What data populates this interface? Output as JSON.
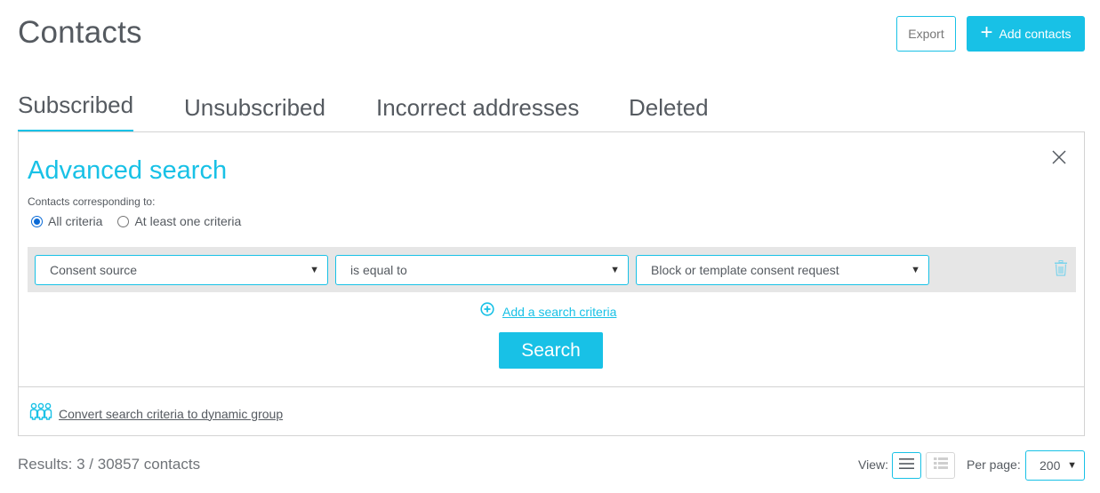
{
  "header": {
    "title": "Contacts",
    "export_label": "Export",
    "add_contacts_label": "Add contacts",
    "add_icon": "plus-icon"
  },
  "tabs": [
    {
      "label": "Subscribed",
      "active": true
    },
    {
      "label": "Unsubscribed",
      "active": false
    },
    {
      "label": "Incorrect addresses",
      "active": false
    },
    {
      "label": "Deleted",
      "active": false
    }
  ],
  "advanced_search": {
    "title": "Advanced search",
    "close_icon": "close-icon",
    "corresponding_label": "Contacts corresponding to:",
    "match_options": [
      {
        "label": "All criteria",
        "checked": true
      },
      {
        "label": "At least one criteria",
        "checked": false
      }
    ],
    "criteria": [
      {
        "field": "Consent source",
        "operator": "is equal to",
        "value": "Block or template consent request",
        "delete_icon": "trash-icon"
      }
    ],
    "add_criteria_label": "Add a search criteria",
    "add_criteria_icon": "plus-circle-icon",
    "search_label": "Search",
    "convert_label": "Convert search criteria to dynamic group",
    "convert_icon": "group-icon"
  },
  "footer": {
    "results_text": "Results: 3 / 30857 contacts",
    "view_label": "View:",
    "view_modes": [
      {
        "name": "list",
        "icon": "list-icon",
        "active": true
      },
      {
        "name": "detailed",
        "icon": "detailed-list-icon",
        "active": false
      }
    ],
    "per_page_label": "Per page:",
    "per_page_value": "200"
  },
  "colors": {
    "accent": "#18c1e6",
    "text": "#555a60",
    "row_bg": "#e6e6e6",
    "border": "#d3d3d3"
  }
}
